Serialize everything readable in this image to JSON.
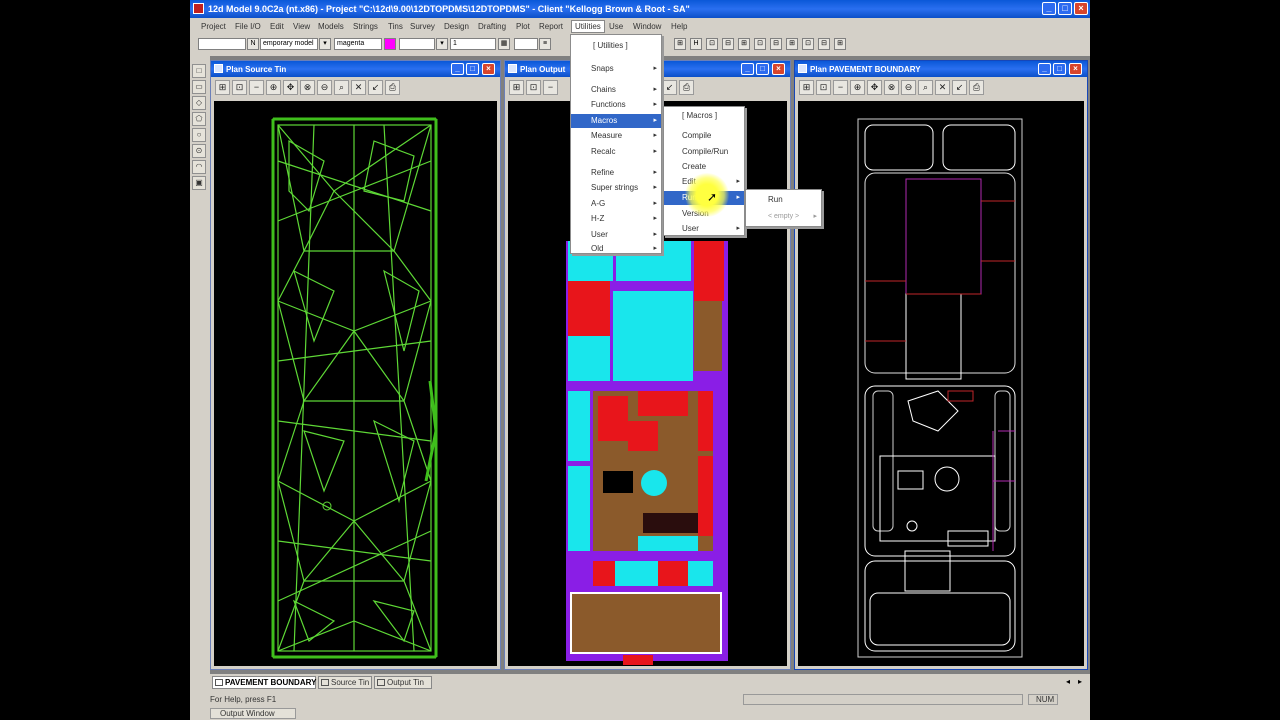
{
  "app": {
    "title": "12d Model 9.0C2a (nt.x86) - Project \"C:\\12d\\9.00\\12DTOPDMS\\12DTOPDMS\" - Client \"Kellogg Brown & Root - SA\""
  },
  "menubar": {
    "items": [
      {
        "label": "Project",
        "active": false
      },
      {
        "label": "File I/O",
        "active": false
      },
      {
        "label": "Edit",
        "active": false
      },
      {
        "label": "View",
        "active": false
      },
      {
        "label": "Models",
        "active": false
      },
      {
        "label": "Strings",
        "active": false
      },
      {
        "label": "Tins",
        "active": false
      },
      {
        "label": "Survey",
        "active": false
      },
      {
        "label": "Design",
        "active": false
      },
      {
        "label": "Drafting",
        "active": false
      },
      {
        "label": "Plot",
        "active": false
      },
      {
        "label": "Report",
        "active": false
      },
      {
        "label": "Utilities",
        "active": true
      },
      {
        "label": "Use",
        "active": false
      },
      {
        "label": "Window",
        "active": false
      },
      {
        "label": "Help",
        "active": false
      }
    ]
  },
  "toolbar": {
    "model_field": "emporary model",
    "colour_field": "magenta",
    "colour_swatch": "#ff00ff",
    "number_field": "1",
    "n_button": "N"
  },
  "windows": {
    "left": {
      "title": "Plan Source Tin"
    },
    "middle": {
      "title": "Plan Output"
    },
    "right": {
      "title": "Plan PAVEMENT BOUNDARY"
    }
  },
  "utilities_menu": {
    "items": [
      {
        "label": "[ Utilities ]",
        "submenu": false,
        "highlighted": false
      },
      {
        "label": "Snaps",
        "submenu": true,
        "highlighted": false
      },
      {
        "label": "Chains",
        "submenu": true,
        "highlighted": false
      },
      {
        "label": "Functions",
        "submenu": true,
        "highlighted": false
      },
      {
        "label": "Macros",
        "submenu": true,
        "highlighted": true
      },
      {
        "label": "Measure",
        "submenu": true,
        "highlighted": false
      },
      {
        "label": "Recalc",
        "submenu": true,
        "highlighted": false
      },
      {
        "label": "Refine",
        "submenu": true,
        "highlighted": false
      },
      {
        "label": "Super strings",
        "submenu": true,
        "highlighted": false
      },
      {
        "label": "A-G",
        "submenu": true,
        "highlighted": false
      },
      {
        "label": "H-Z",
        "submenu": true,
        "highlighted": false
      },
      {
        "label": "User",
        "submenu": true,
        "highlighted": false
      },
      {
        "label": "Old",
        "submenu": true,
        "highlighted": false
      }
    ]
  },
  "macros_menu": {
    "items": [
      {
        "label": "[ Macros ]",
        "submenu": false,
        "highlighted": false
      },
      {
        "label": "Compile",
        "submenu": false,
        "highlighted": false
      },
      {
        "label": "Compile/Run",
        "submenu": false,
        "highlighted": false
      },
      {
        "label": "Create",
        "submenu": false,
        "highlighted": false
      },
      {
        "label": "Edit",
        "submenu": true,
        "highlighted": false
      },
      {
        "label": "Run",
        "submenu": true,
        "highlighted": true
      },
      {
        "label": "Version",
        "submenu": false,
        "highlighted": false
      },
      {
        "label": "User",
        "submenu": true,
        "highlighted": false
      }
    ]
  },
  "run_menu": {
    "items": [
      {
        "label": "Run",
        "submenu": false,
        "disabled": false
      },
      {
        "label": "< empty >",
        "submenu": true,
        "disabled": true
      }
    ]
  },
  "tabs": [
    {
      "label": "PAVEMENT BOUNDARY",
      "active": true
    },
    {
      "label": "Source Tin",
      "active": false
    },
    {
      "label": "Output Tin",
      "active": false
    }
  ],
  "status": {
    "help_text": "For Help, press F1",
    "num_indicator": "NUM",
    "output_window": "Output Window"
  },
  "icons": {
    "app": "12d-app-icon",
    "view_tools": [
      "pick-icon",
      "fit-icon",
      "zoom-in-icon",
      "zoom-out-icon",
      "pan-icon",
      "zoom-window-icon",
      "redraw-icon",
      "measure-icon",
      "settings-icon",
      "print-icon"
    ]
  }
}
